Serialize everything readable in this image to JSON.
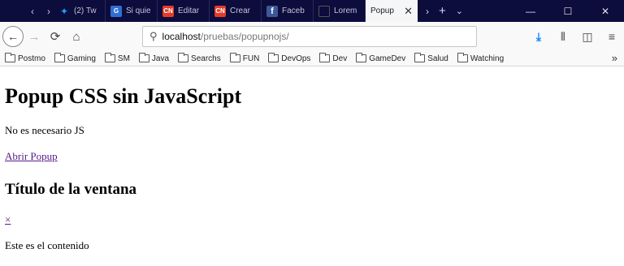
{
  "tabs": [
    {
      "title": "(2) Tw",
      "icon": "twitter-icon",
      "color": "#1da1f2",
      "glyph": "🐦"
    },
    {
      "title": "Si quie",
      "icon": "ga-icon",
      "color": "#2f6fd1",
      "glyph": "G"
    },
    {
      "title": "Editar",
      "icon": "cn-icon",
      "color": "#e23b2a",
      "glyph": "CN"
    },
    {
      "title": "Crear",
      "icon": "cn-icon",
      "color": "#e23b2a",
      "glyph": "CN"
    },
    {
      "title": "Faceb",
      "icon": "facebook-icon",
      "color": "#3b5998",
      "glyph": "f"
    },
    {
      "title": "Lorem",
      "icon": "generic-page-icon",
      "color": "#2a2a5a",
      "glyph": ""
    },
    {
      "title": "Popup",
      "icon": "generic-page-icon",
      "color": "#ffffff",
      "glyph": "",
      "active": true
    }
  ],
  "toolbar": {
    "url_host": "localhost",
    "url_path": "/pruebas/popupnojs/"
  },
  "bookmarks": [
    "Postmo",
    "Gaming",
    "SM",
    "Java",
    "Searchs",
    "FUN",
    "DevOps",
    "Dev",
    "GameDev",
    "Salud",
    "Watching"
  ],
  "page": {
    "heading": "Popup CSS sin JavaScript",
    "intro": "No es necesario JS",
    "open_link": "Abrir Popup",
    "window_title": "Título de la ventana",
    "close_link": "×",
    "content": "Este es el contenido"
  }
}
